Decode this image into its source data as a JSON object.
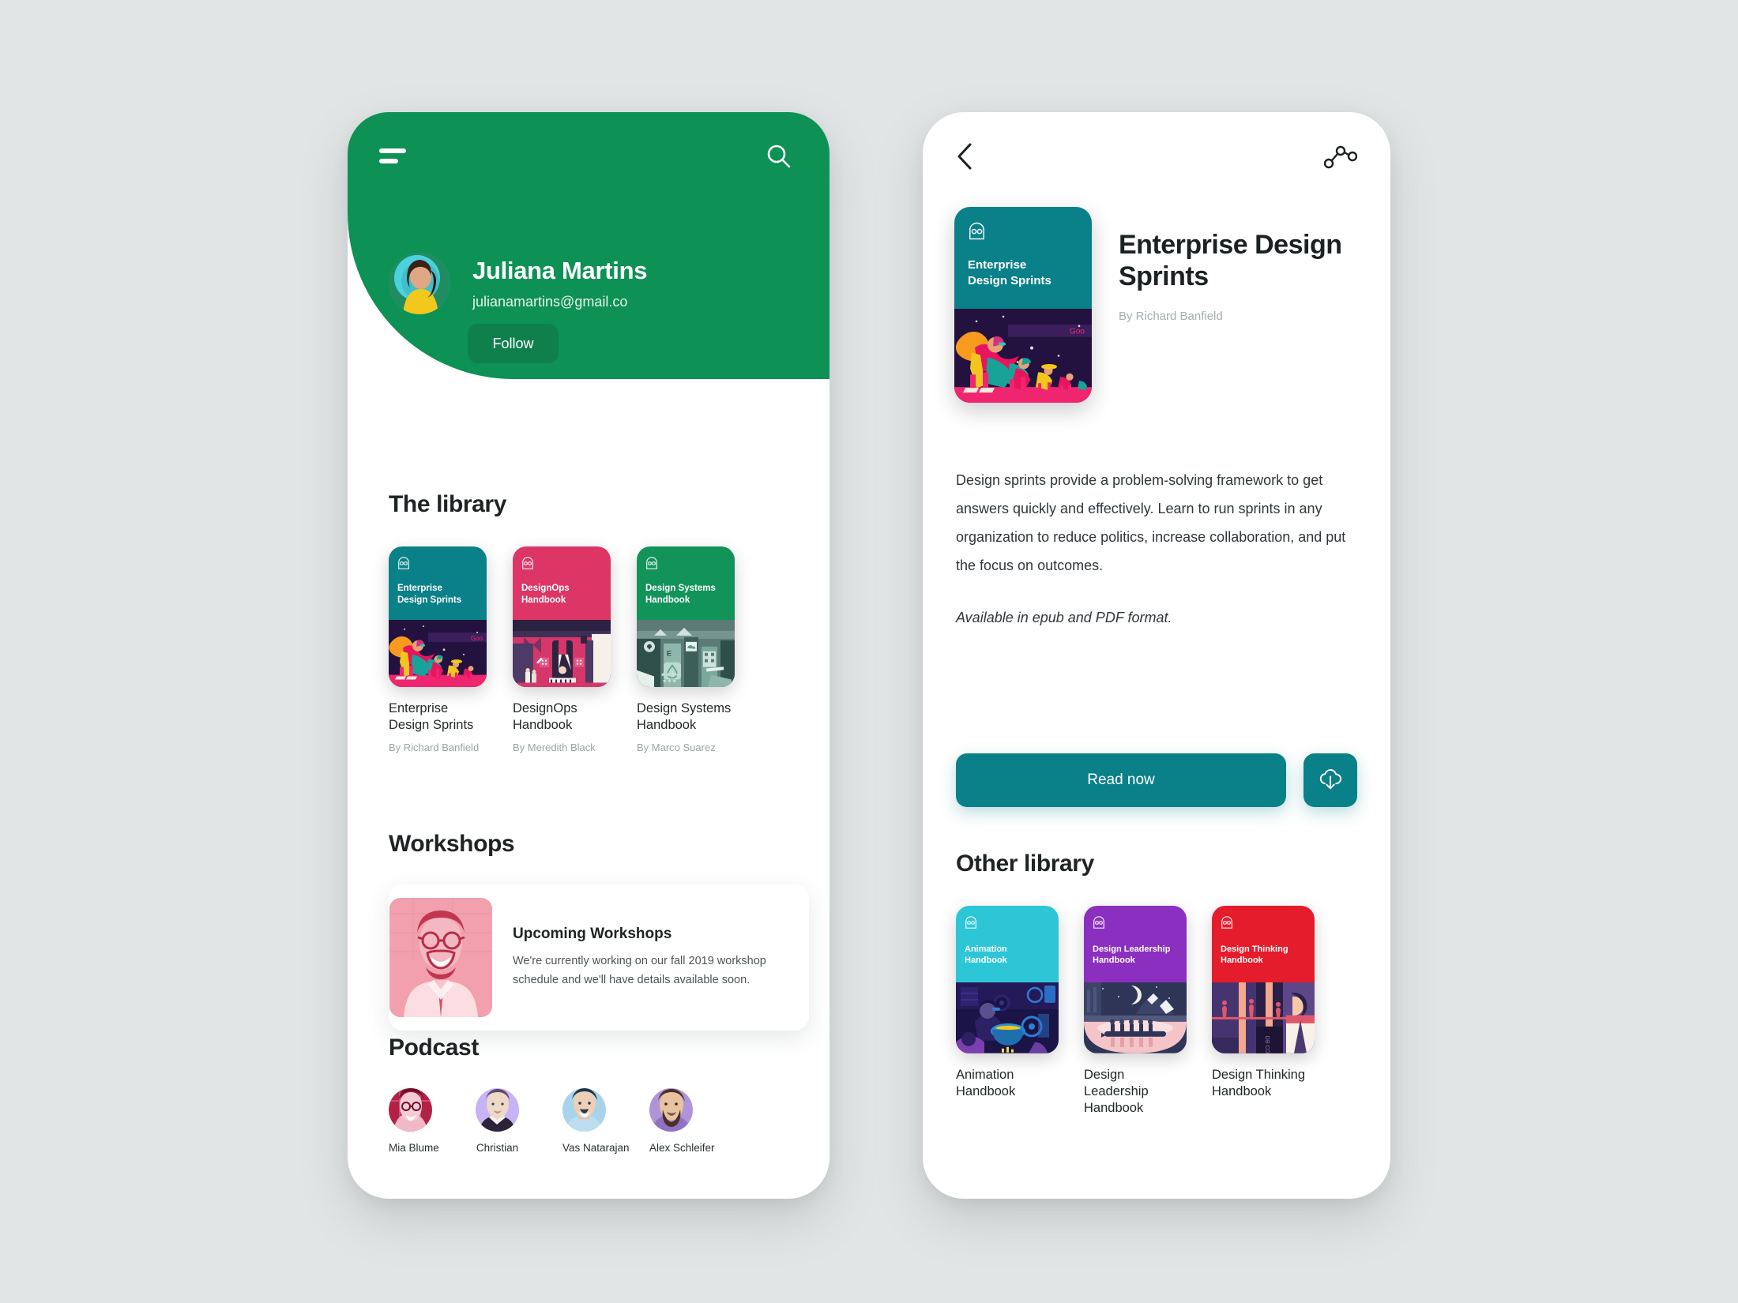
{
  "app": {
    "background_color": "#e2e5e5",
    "brand_green": "#0d9155",
    "brand_teal": "#0a8089"
  },
  "left_screen": {
    "header": {
      "menu_icon": "hamburger-icon",
      "search_icon": "search-icon",
      "user_name": "Juliana Martins",
      "user_email": "julianamartins@gmail.co",
      "follow_label": "Follow",
      "avatar": "user-avatar"
    },
    "library": {
      "title": "The library",
      "books": [
        {
          "cover_title": "Enterprise\nDesign Sprints",
          "cover_line1": "Enterprise",
          "cover_line2": "Design Sprints",
          "name": "Enterprise Design Sprints",
          "author": "By Richard Banfield",
          "color": "#0a8089"
        },
        {
          "cover_line1": "DesignOps",
          "cover_line2": "Handbook",
          "name": "DesignOps Handbook",
          "author": "By Meredith Black",
          "color": "#dd3666"
        },
        {
          "cover_line1": "Design Systems",
          "cover_line2": "Handbook",
          "name": "Design Systems Handbook",
          "author": "By Marco Suarez",
          "color": "#12935a"
        }
      ]
    },
    "workshops": {
      "title": "Workshops",
      "card": {
        "heading": "Upcoming Workshops",
        "body": "We're currently working on our fall 2019 workshop schedule and we'll have details available soon."
      }
    },
    "podcast": {
      "title": "Podcast",
      "hosts": [
        {
          "name": "Mia Blume",
          "tint": "#c92a52"
        },
        {
          "name": "Christian",
          "tint": "#c0a9f0"
        },
        {
          "name": "Vas Natarajan",
          "tint": "#9fd0ea"
        },
        {
          "name": "Alex Schleifer",
          "tint": "#a98cd8"
        }
      ]
    }
  },
  "right_screen": {
    "header": {
      "back_icon": "chevron-left-icon",
      "share_icon": "share-icon"
    },
    "book": {
      "cover_line1": "Enterprise",
      "cover_line2": "Design Sprints",
      "title": "Enterprise Design Sprints",
      "author": "By Richard Banfield",
      "description": "Design sprints provide a problem-solving framework to get answers quickly and effectively. Learn to run sprints in any organization to reduce politics, increase collaboration, and put the focus on outcomes.",
      "format_note": "Available in epub and PDF format.",
      "cover_color": "#0a8089"
    },
    "actions": {
      "read_label": "Read now",
      "download_icon": "cloud-download-icon"
    },
    "other_library": {
      "title": "Other library",
      "books": [
        {
          "cover_line1": "Animation",
          "cover_line2": "Handbook",
          "name": "Animation Handbook",
          "color": "#2dc6d6"
        },
        {
          "cover_line1": "Design Leadership",
          "cover_line2": "Handbook",
          "name": "Design Leadership Handbook",
          "color": "#8a2fc0"
        },
        {
          "cover_line1": "Design Thinking",
          "cover_line2": "Handbook",
          "name": "Design Thinking Handbook",
          "color": "#e51c2b"
        }
      ]
    }
  }
}
